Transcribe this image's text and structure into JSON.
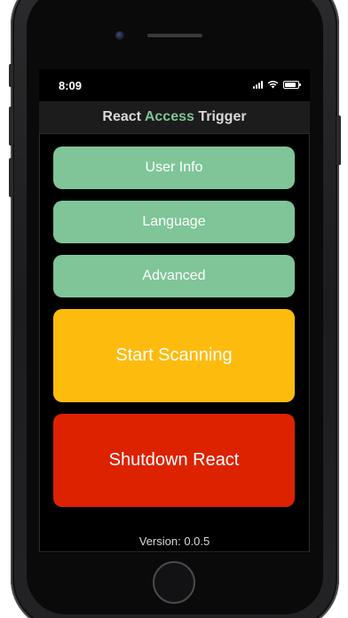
{
  "status_bar": {
    "time": "8:09",
    "battery_level": 0.85
  },
  "nav": {
    "title_part1": "React ",
    "title_part2": "Access",
    "title_part3": " Trigger"
  },
  "menu": {
    "user_info": "User Info",
    "language": "Language",
    "advanced": "Advanced",
    "start_scanning": "Start Scanning",
    "shutdown": "Shutdown React"
  },
  "footer": {
    "version": "Version: 0.0.5"
  },
  "colors": {
    "accent_green": "#7fc597",
    "scan_yellow": "#fdbb0e",
    "shutdown_red": "#dd2200",
    "nav_background": "#1c1c1c",
    "screen_background": "#000000"
  },
  "icons": [
    "signal-icon",
    "wifi-icon",
    "battery-icon"
  ]
}
